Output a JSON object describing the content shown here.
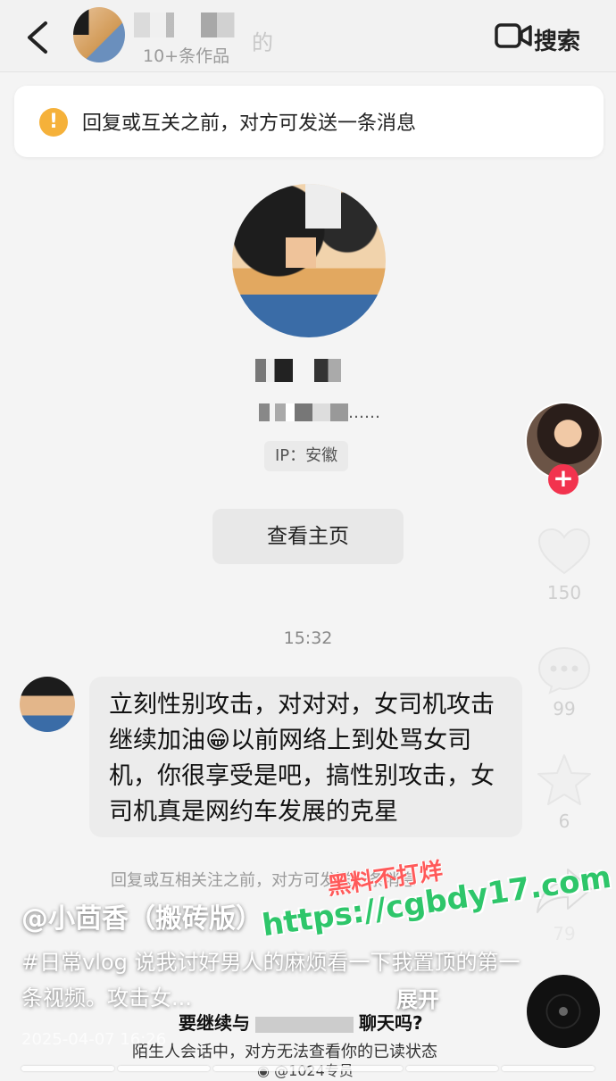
{
  "header": {
    "name_suffix": "的",
    "works_count": "10+条作品",
    "search_label": "搜索",
    "icons": {
      "back": "back-chevron-icon",
      "video": "video-call-icon"
    }
  },
  "notice": {
    "text": "回复或互关之前，对方可发送一条消息",
    "icon": "warning-icon",
    "icon_glyph": "!",
    "icon_color": "#f5b13a"
  },
  "profile": {
    "bio_ellipsis": "……",
    "ip": "IP：安徽",
    "home_button": "查看主页"
  },
  "chat": {
    "timestamp": "15:32",
    "message": "立刻性别攻击，对对对，女司机攻击继续加油😁以前网络上到处骂女司机，你很享受是吧，搞性别攻击，女司机真是网约车发展的克星"
  },
  "bottom_notice": "回复或互相关注之前，对方可发送一条消息",
  "video_overlay": {
    "follow_glyph": "+",
    "follow_color": "#f2334e",
    "likes": "150",
    "comments": "99",
    "favorites": "6",
    "shares": "79",
    "author": "@小茴香（搬砖版）",
    "caption": "#日常vlog 说我讨好男人的麻烦看一下我置顶的第一条视频。攻击女...",
    "expand": "展开",
    "datetime": "2025-04-07 16:26"
  },
  "dialog": {
    "prefix": "要继续与",
    "suffix": "聊天吗?",
    "read_status": "陌生人会话中，对方无法查看你的已读状态"
  },
  "watermarks": {
    "red": "黑料不打烊",
    "green": "https://cgbdy17.com",
    "weibo": "@1024专员"
  }
}
